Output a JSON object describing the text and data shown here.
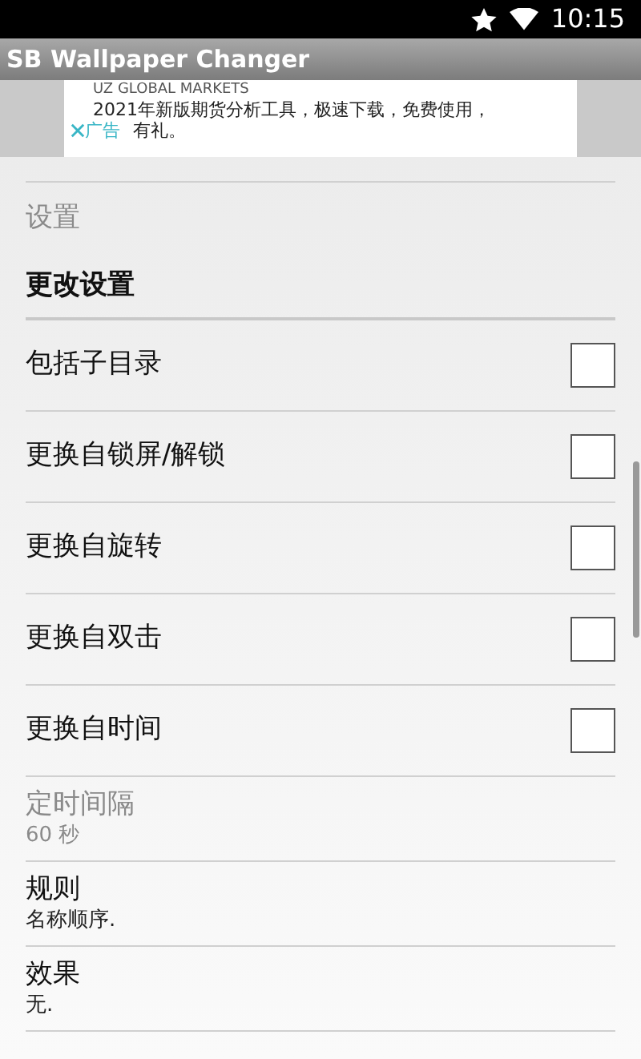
{
  "status_bar": {
    "time": "10:15"
  },
  "window": {
    "title": "SB Wallpaper Changer"
  },
  "ad": {
    "advertiser": "UZ GLOBAL MARKETS",
    "line_1": "2021年新版期货分析工具，极速下载，免费使用，",
    "line_2": "有礼。",
    "badge": "广告"
  },
  "category": {
    "title": "设置",
    "disabled": true
  },
  "section": {
    "title": "更改设置"
  },
  "settings": [
    {
      "kind": "checkbox",
      "title": "包括子目录",
      "checked": false
    },
    {
      "kind": "checkbox",
      "title": "更换自锁屏/解锁",
      "checked": false
    },
    {
      "kind": "checkbox",
      "title": "更换自旋转",
      "checked": false
    },
    {
      "kind": "checkbox",
      "title": "更换自双击",
      "checked": false
    },
    {
      "kind": "checkbox",
      "title": "更换自时间",
      "checked": false
    },
    {
      "kind": "summary",
      "title": "定时间隔",
      "summary": "60 秒",
      "disabled": true
    },
    {
      "kind": "summary",
      "title": "规则",
      "summary": "名称顺序.",
      "disabled": false
    },
    {
      "kind": "summary",
      "title": "效果",
      "summary": "无.",
      "disabled": false
    }
  ]
}
